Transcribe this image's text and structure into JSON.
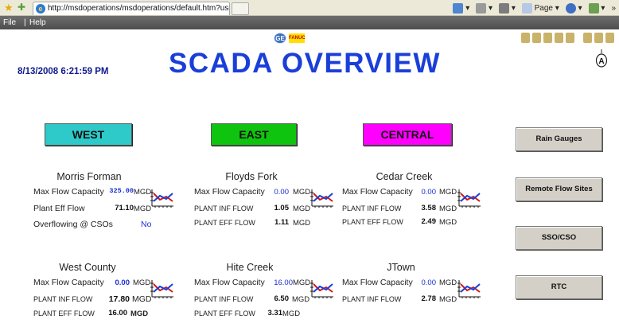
{
  "browser": {
    "tab_title": "http://msdoperations/msdoperations/default.htm?use...",
    "cmd_page": "Page",
    "menu_file": "File",
    "menu_sep": "|",
    "menu_help": "Help",
    "ge_logo": "GE",
    "fanuc_logo": "FANUC"
  },
  "page": {
    "datetime": "8/13/2008  6:21:59 PM",
    "title": "SCADA OVERVIEW",
    "regions": {
      "west": "WEST",
      "east": "EAST",
      "central": "CENTRAL"
    },
    "side_buttons": {
      "rain_gauges": "Rain Gauges",
      "remote_flow_sites": "Remote Flow Sites",
      "sso_cso": "SSO/CSO",
      "rtc": "RTC"
    },
    "labels": {
      "max_flow": "Max Flow Capacity",
      "plant_eff_flow_mixed": "Plant Eff Flow",
      "plant_inf_flow": "PLANT INF FLOW",
      "plant_eff_flow": "PLANT EFF FLOW",
      "overflowing": "Overflowing @ CSOs",
      "mgd": "MGD"
    },
    "plants": {
      "morris_forman": {
        "name": "Morris Forman",
        "max_flow": "325.00",
        "eff_flow": "71.10",
        "overflowing": "No"
      },
      "floyds_fork": {
        "name": "Floyds Fork",
        "max_flow": "0.00",
        "inf_flow": "1.05",
        "eff_flow": "1.11"
      },
      "cedar_creek": {
        "name": "Cedar Creek",
        "max_flow": "0.00",
        "inf_flow": "3.58",
        "eff_flow": "2.49"
      },
      "west_county": {
        "name": "West County",
        "max_flow": "0.00",
        "inf_flow": "17.80",
        "eff_flow": "16.00"
      },
      "hite_creek": {
        "name": "Hite Creek",
        "max_flow": "16.00",
        "inf_flow": "6.50",
        "eff_flow": "3.31"
      },
      "jtown": {
        "name": "JTown",
        "max_flow": "0.00",
        "inf_flow": "2.78"
      }
    }
  }
}
